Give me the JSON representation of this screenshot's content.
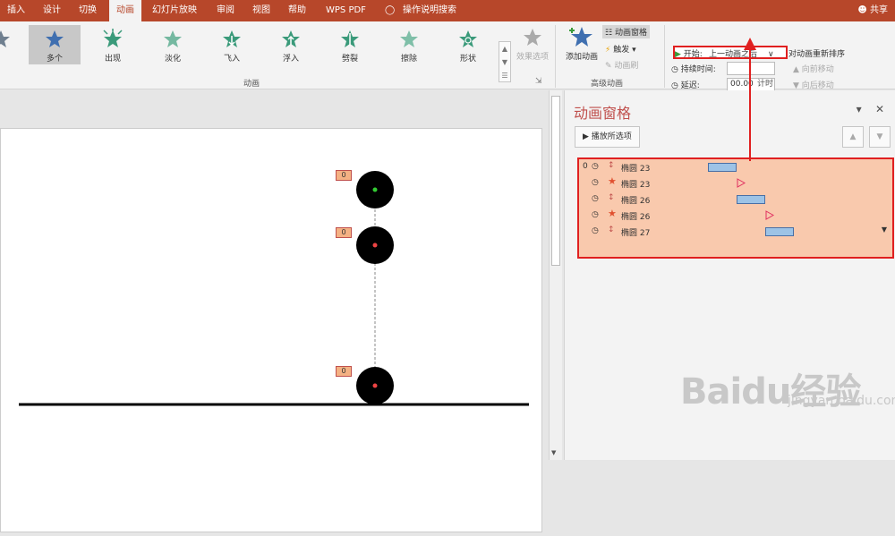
{
  "tabs": [
    "插入",
    "设计",
    "切换",
    "动画",
    "幻灯片放映",
    "审阅",
    "视图",
    "帮助",
    "WPS PDF",
    "操作说明搜索"
  ],
  "share": "共享",
  "gallery": [
    {
      "label": "",
      "icon": "star-icon"
    },
    {
      "label": "多个",
      "icon": "star-icon"
    },
    {
      "label": "出现",
      "icon": "star-burst-icon"
    },
    {
      "label": "淡化",
      "icon": "star-icon"
    },
    {
      "label": "飞入",
      "icon": "star-fly-icon"
    },
    {
      "label": "浮入",
      "icon": "star-float-icon"
    },
    {
      "label": "劈裂",
      "icon": "star-split-icon"
    },
    {
      "label": "擦除",
      "icon": "star-wipe-icon"
    },
    {
      "label": "形状",
      "icon": "star-shape-icon"
    }
  ],
  "effect_options": "效果选项",
  "group_animation": "动画",
  "add_animation": "添加动画",
  "anim_pane_btn": "动画窗格",
  "trigger": "触发",
  "anim_brush": "动画刷",
  "group_advanced": "高级动画",
  "start_label": "开始:",
  "start_value": "上一动画之后",
  "duration_label": "持续时间:",
  "delay_label": "延迟:",
  "delay_value": "00.00",
  "reorder": "对动画重新排序",
  "move_earlier": "向前移动",
  "move_later": "向后移动",
  "group_timing": "计时",
  "pane_title": "动画窗格",
  "play_all": "播放所选项",
  "markers": [
    "0",
    "0",
    "0"
  ],
  "rows": [
    {
      "index": "0",
      "type": "path",
      "name": "椭圆 23"
    },
    {
      "index": "",
      "type": "emphasis",
      "name": "椭圆 23"
    },
    {
      "index": "",
      "type": "path",
      "name": "椭圆 26"
    },
    {
      "index": "",
      "type": "emphasis",
      "name": "椭圆 26"
    },
    {
      "index": "",
      "type": "path",
      "name": "椭圆 27"
    }
  ],
  "watermark": "Baidu经验",
  "watermark_url": "jingyan.baidu.com"
}
